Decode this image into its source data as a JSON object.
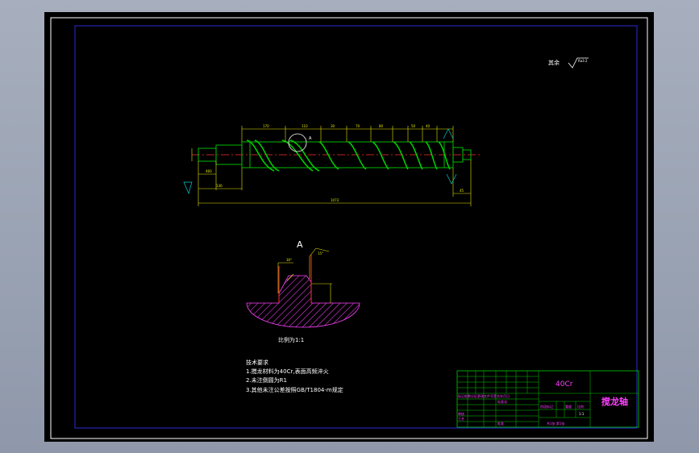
{
  "drawing": {
    "surface_note": "其余",
    "roughness_value": "Ra3.2",
    "section_label": "A",
    "detail_marker": "A",
    "scale_note": "比例为1:1",
    "angle_left": "30°",
    "angle_right": "15°"
  },
  "dimensions": {
    "top": [
      "170",
      "110",
      "30",
      "70",
      "80",
      "50",
      "40"
    ],
    "overall": "1073",
    "left_a": "460",
    "left_b": "136",
    "right_end": "45"
  },
  "tech_requirements": {
    "heading": "技术要求",
    "items": [
      "1.搅龙材料为40Cr,表面高频淬火",
      "2.未注倒圆为R1",
      "3.其他未注公差按照GB/T1804-m规定"
    ]
  },
  "title_block": {
    "material": "40Cr",
    "part_name": "搅龙轴",
    "mid_row_1": "阶段标记",
    "mid_row_1b": "重量",
    "mid_row_1c": "比例",
    "scale": "1:1",
    "sheet_info": "共1张 第1张",
    "col_label_1": "标记处数分区更改文件号签名年月日",
    "col_label_2": "标准化",
    "col_label_3": "审核",
    "col_label_4": "工艺",
    "col_label_5": "批准"
  },
  "colors": {
    "background": "#000000",
    "outer_frame": "#ffffff",
    "inner_frame": "#2a2ad8",
    "dimension": "#e6e600",
    "part_outline": "#00cc00",
    "center_line": "#ff3030",
    "text": "#ffffff",
    "title_text": "#ff40ff",
    "hatch": "#ff40ff"
  }
}
